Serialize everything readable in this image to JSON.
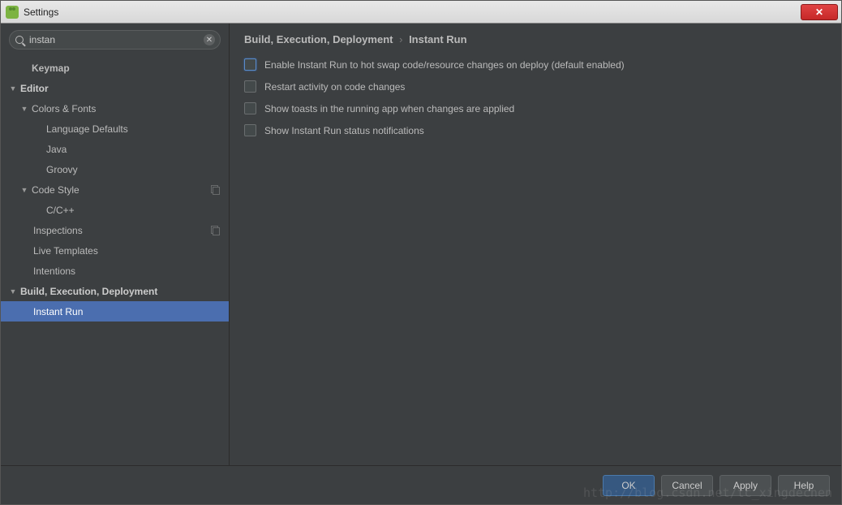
{
  "window": {
    "title": "Settings"
  },
  "search": {
    "value": "instan"
  },
  "tree": {
    "keymap": "Keymap",
    "editor": "Editor",
    "colors_fonts": "Colors & Fonts",
    "language_defaults": "Language Defaults",
    "java": "Java",
    "groovy": "Groovy",
    "code_style": "Code Style",
    "c_cpp": "C/C++",
    "inspections": "Inspections",
    "live_templates": "Live Templates",
    "intentions": "Intentions",
    "build": "Build, Execution, Deployment",
    "instant_run": "Instant Run"
  },
  "breadcrumb": {
    "parent": "Build, Execution, Deployment",
    "sep": "›",
    "current": "Instant Run"
  },
  "options": {
    "enable": "Enable Instant Run to hot swap code/resource changes on deploy (default enabled)",
    "restart": "Restart activity on code changes",
    "toast": "Show toasts in the running app when changes are applied",
    "notify": "Show Instant Run status notifications"
  },
  "buttons": {
    "ok": "OK",
    "cancel": "Cancel",
    "apply": "Apply",
    "help": "Help"
  },
  "watermark": "http://blog.csdn.net/tc_xingdechen"
}
